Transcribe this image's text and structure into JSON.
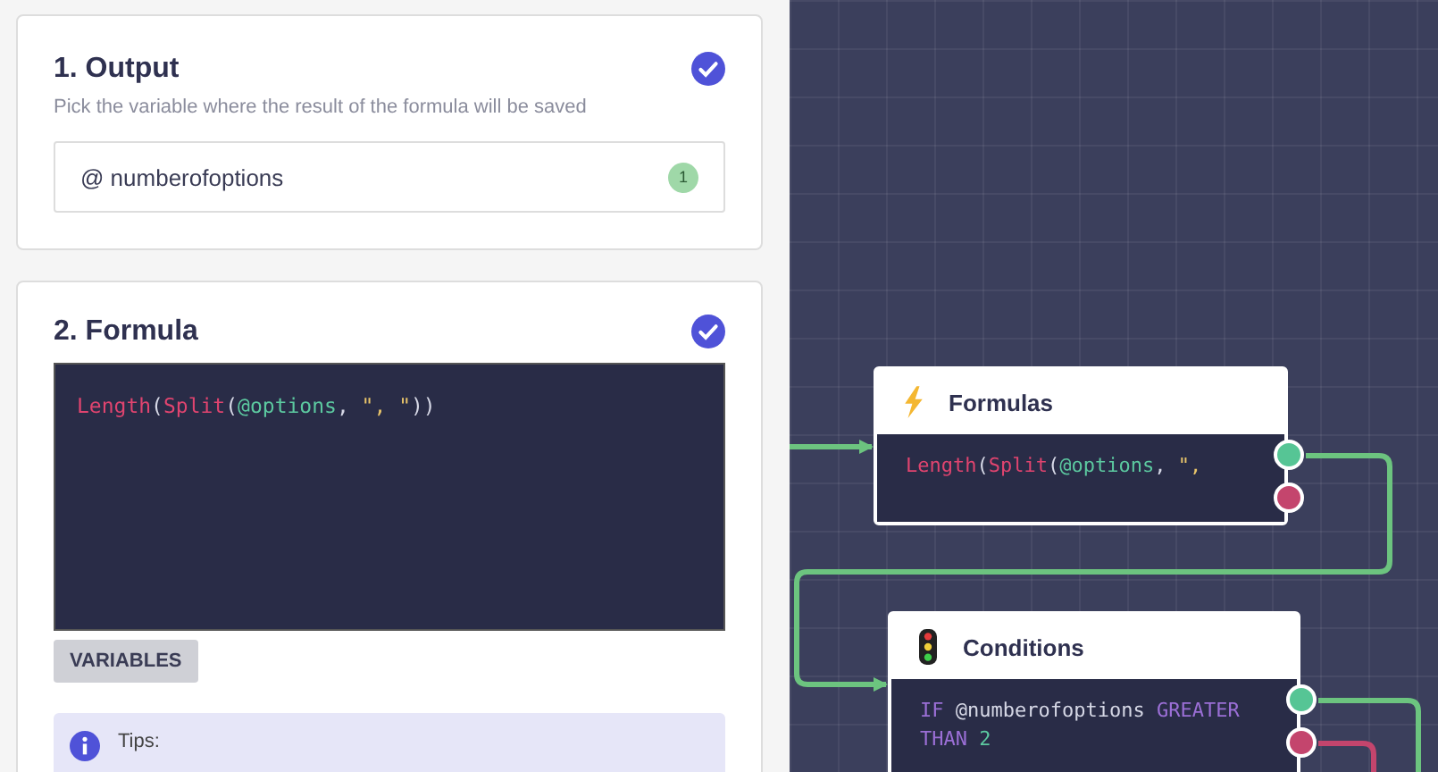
{
  "output_step": {
    "title": "1. Output",
    "done": true,
    "hint": "Pick the variable where the result of the formula will be saved",
    "field": {
      "prefix": "@",
      "value": "numberofoptions",
      "badge": "1"
    }
  },
  "formula_step": {
    "title": "2. Formula",
    "done": true,
    "code": [
      {
        "kind": "func",
        "text": "Length"
      },
      {
        "kind": "punct",
        "text": "("
      },
      {
        "kind": "func",
        "text": "Split"
      },
      {
        "kind": "punct",
        "text": "("
      },
      {
        "kind": "var",
        "text": "@options"
      },
      {
        "kind": "punct",
        "text": ", "
      },
      {
        "kind": "string",
        "text": "\", \""
      },
      {
        "kind": "punct",
        "text": "))"
      }
    ],
    "variables_button": "VARIABLES",
    "tips": {
      "title": "Tips:"
    }
  },
  "canvas": {
    "nodes": [
      {
        "kind": "formula",
        "title": "Formulas",
        "lines": [
          [
            {
              "kind": "func",
              "text": "Length"
            },
            {
              "kind": "punct",
              "text": "("
            },
            {
              "kind": "func",
              "text": "Split"
            },
            {
              "kind": "punct",
              "text": "("
            },
            {
              "kind": "var",
              "text": "@options"
            },
            {
              "kind": "punct",
              "text": ", "
            },
            {
              "kind": "string",
              "text": "\","
            }
          ]
        ]
      },
      {
        "kind": "condition",
        "title": "Conditions",
        "lines": [
          [
            {
              "kind": "keyword",
              "text": "IF"
            },
            {
              "kind": "punct",
              "text": " @numberofoptions "
            },
            {
              "kind": "keyword",
              "text": "GREATER"
            }
          ],
          [
            {
              "kind": "keyword",
              "text": "THAN "
            },
            {
              "kind": "number",
              "text": "2"
            }
          ]
        ]
      }
    ]
  }
}
